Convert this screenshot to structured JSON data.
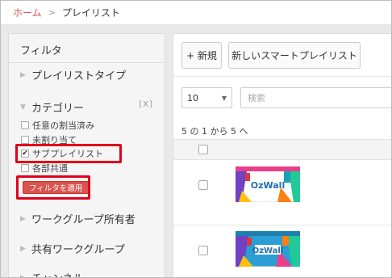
{
  "breadcrumb": {
    "home": "ホーム",
    "separator": ">",
    "current": "プレイリスト"
  },
  "sidebar": {
    "title": "フィルタ",
    "sections": [
      {
        "label": "プレイリストタイプ",
        "expanded": false
      },
      {
        "label": "カテゴリー",
        "expanded": true
      },
      {
        "label": "ワークグループ所有者",
        "expanded": false
      },
      {
        "label": "共有ワークグループ",
        "expanded": false
      },
      {
        "label": "チャンネル",
        "expanded": false
      }
    ],
    "clear_label": "[X]",
    "categories": [
      {
        "label": "任意の割当済み",
        "checked": false
      },
      {
        "label": "未割り当て",
        "checked": false
      },
      {
        "label": "サブプレイリスト",
        "checked": true
      },
      {
        "label": "各部共通",
        "checked": false
      }
    ],
    "apply_label": "フィルタを適用"
  },
  "toolbar": {
    "new_label": "+ 新規",
    "new_smart_label": "新しいスマートプレイリスト"
  },
  "list": {
    "page_size": "10",
    "search_placeholder": "検索",
    "count_text": "5 の 1 から 5 へ",
    "thumbnail_label": "OzWall"
  },
  "colors": {
    "accent": "#d9534f",
    "highlight": "#e0001b"
  },
  "icons": {
    "collapsed": "triangle-right-icon",
    "expanded": "triangle-down-icon",
    "dropdown": "chevron-down-icon",
    "checkbox_checked": "checkmark-icon"
  }
}
